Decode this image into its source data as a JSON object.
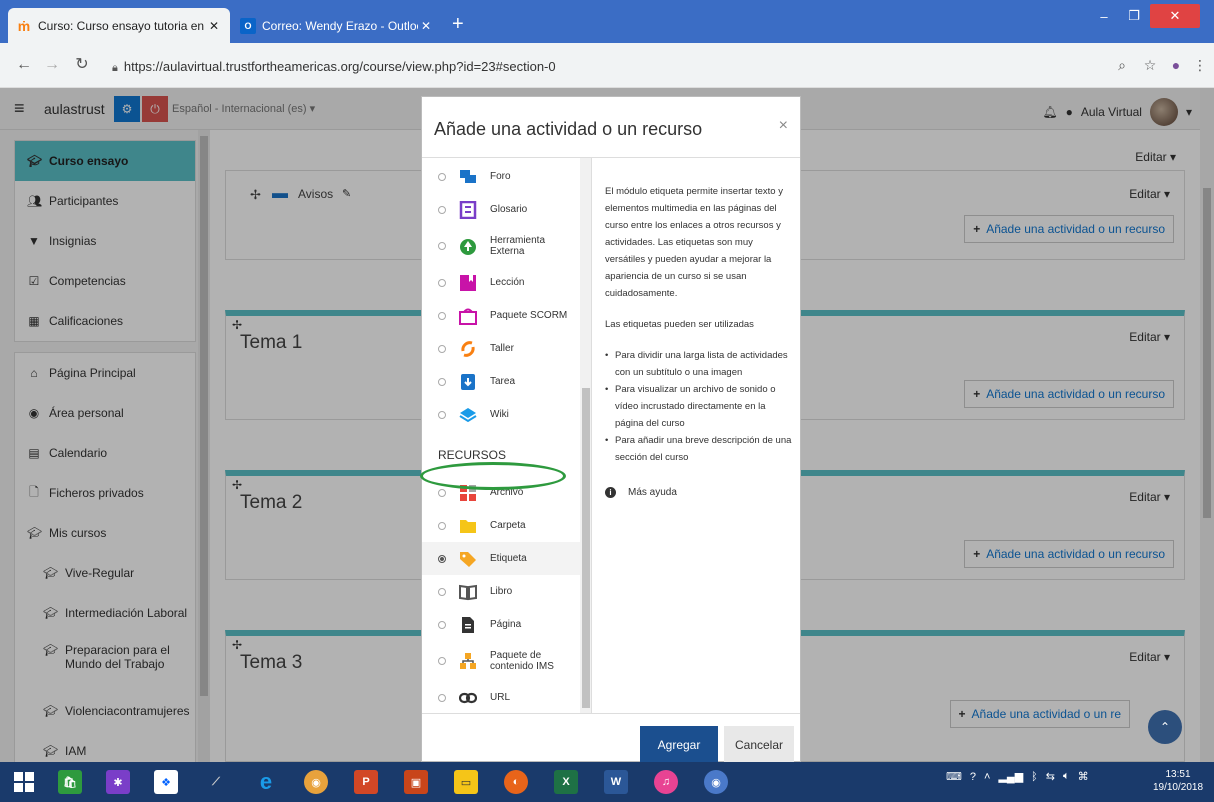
{
  "browser": {
    "tabs": [
      {
        "title": "Curso: Curso ensayo tutoria en e",
        "close": "✕"
      },
      {
        "title": "Correo: Wendy Erazo - Outlook",
        "close": "✕"
      }
    ],
    "new_tab": "+",
    "url": "https://aulavirtual.trustfortheamericas.org/course/view.php?id=23#section-0"
  },
  "navbar": {
    "site_name": "aulastrust",
    "language": "Español - Internacional (es) ▾",
    "user_name": "Aula Virtual"
  },
  "drawer": {
    "primary": [
      {
        "label": "Curso ensayo",
        "icon": "graduation-cap-icon"
      },
      {
        "label": "Participantes",
        "icon": "users-icon"
      },
      {
        "label": "Insignias",
        "icon": "badge-icon"
      },
      {
        "label": "Competencias",
        "icon": "checkbox-icon"
      },
      {
        "label": "Calificaciones",
        "icon": "table-icon"
      }
    ],
    "secondary": [
      {
        "label": "Página Principal",
        "icon": "home-icon"
      },
      {
        "label": "Área personal",
        "icon": "dashboard-icon"
      },
      {
        "label": "Calendario",
        "icon": "calendar-icon"
      },
      {
        "label": "Ficheros privados",
        "icon": "file-icon"
      },
      {
        "label": "Mis cursos",
        "icon": "graduation-cap-icon"
      },
      {
        "label": "Vive-Regular",
        "icon": "graduation-cap-icon"
      },
      {
        "label": "Intermediación Laboral",
        "icon": "graduation-cap-icon"
      },
      {
        "label": "Preparacion para el Mundo del Trabajo",
        "icon": "graduation-cap-icon"
      },
      {
        "label": "Violenciacontramujeres",
        "icon": "graduation-cap-icon"
      },
      {
        "label": "IAM",
        "icon": "graduation-cap-icon"
      }
    ]
  },
  "course": {
    "editar": "Editar ▾",
    "avisos": "Avisos",
    "add_activity": "Añade una actividad o un recurso",
    "add_activity_cut": "Añade una actividad o un re",
    "sections": [
      "Tema 1",
      "Tema 2",
      "Tema 3"
    ]
  },
  "modal": {
    "title": "Añade una actividad o un recurso",
    "close": "×",
    "activities": [
      {
        "label": "Foro",
        "icon": "forum-icon",
        "color": "#1a73c8"
      },
      {
        "label": "Glosario",
        "icon": "glossary-icon",
        "color": "#7a3ec8"
      },
      {
        "label": "Herramienta Externa",
        "icon": "external-tool-icon",
        "color": "#2e9a3e"
      },
      {
        "label": "Lección",
        "icon": "lesson-icon",
        "color": "#c813a8"
      },
      {
        "label": "Paquete SCORM",
        "icon": "scorm-icon",
        "color": "#c813a8"
      },
      {
        "label": "Taller",
        "icon": "workshop-icon",
        "color": "#f98012"
      },
      {
        "label": "Tarea",
        "icon": "assignment-icon",
        "color": "#1a73c8"
      },
      {
        "label": "Wiki",
        "icon": "wiki-icon",
        "color": "#1a9be8"
      }
    ],
    "resources_label": "RECURSOS",
    "resources": [
      {
        "label": "Archivo",
        "icon": "file-resource-icon",
        "color": "#e8453c"
      },
      {
        "label": "Carpeta",
        "icon": "folder-icon",
        "color": "#f5c518"
      },
      {
        "label": "Etiqueta",
        "icon": "tag-icon",
        "color": "#f5a623",
        "selected": true
      },
      {
        "label": "Libro",
        "icon": "book-icon",
        "color": "#555555"
      },
      {
        "label": "Página",
        "icon": "page-icon",
        "color": "#333333"
      },
      {
        "label": "Paquete de contenido IMS",
        "icon": "ims-package-icon",
        "color": "#f5a623"
      },
      {
        "label": "URL",
        "icon": "link-icon",
        "color": "#333333"
      }
    ],
    "description": {
      "p1": "El módulo etiqueta permite insertar texto y elementos multimedia en las páginas del curso entre los enlaces a otros recursos y actividades. Las etiquetas son muy versátiles y pueden ayudar a mejorar la apariencia de un curso si se usan cuidadosamente.",
      "p2": "Las etiquetas pueden ser utilizadas",
      "bullets": [
        "Para dividir una larga lista de actividades con un subtítulo o una imagen",
        "Para visualizar un archivo de sonido o vídeo incrustado directamente en la página del curso",
        "Para añadir una breve descripción de una sección del curso"
      ],
      "help": "Más ayuda"
    },
    "add_button": "Agregar",
    "cancel_button": "Cancelar"
  },
  "taskbar": {
    "time": "13:51",
    "date": "19/10/2018"
  }
}
